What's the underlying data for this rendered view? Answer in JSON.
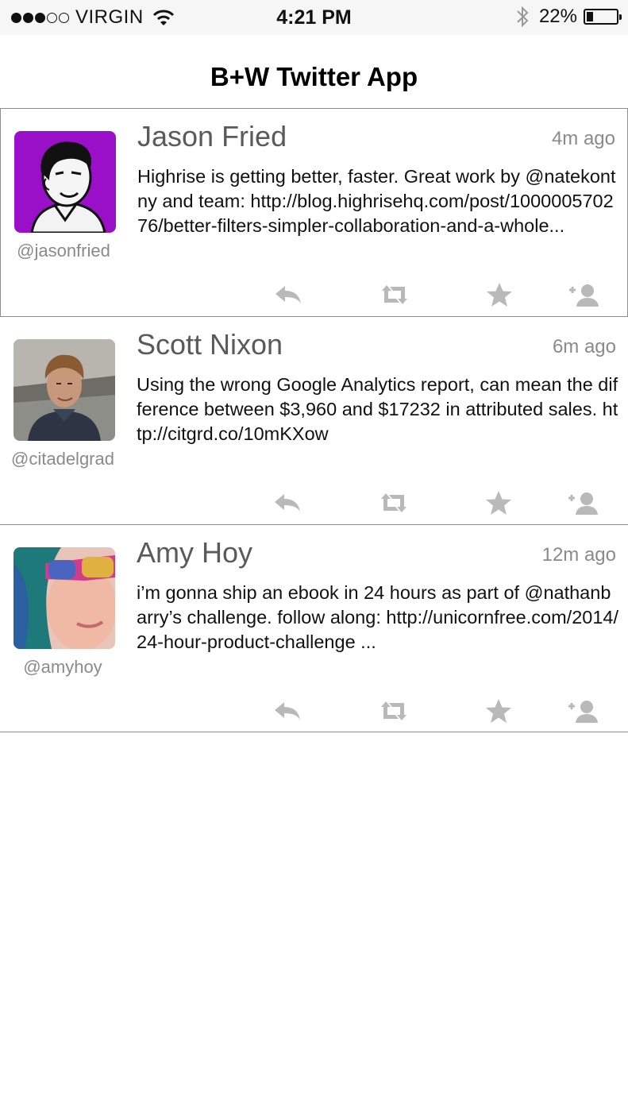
{
  "status_bar": {
    "carrier": "VIRGIN",
    "time": "4:21 PM",
    "battery_percent_text": "22%",
    "battery_level": 0.22
  },
  "header": {
    "title": "B+W Twitter App"
  },
  "tweets": [
    {
      "name": "Jason Fried",
      "handle": "@jasonfried",
      "time_ago": "4m ago",
      "text": "Highrise is getting better, faster. Great work by @natekontny and team: http://blog.highrisehq.com/post/100000570276/better-filters-simpler-collaboration-and-a-whole..."
    },
    {
      "name": "Scott Nixon",
      "handle": "@citadelgrad",
      "time_ago": "6m ago",
      "text": "Using the wrong Google Analytics report, can mean the difference between $3,960 and $17232 in attributed sales. http://citgrd.co/10mKXow"
    },
    {
      "name": "Amy Hoy",
      "handle": "@amyhoy",
      "time_ago": "12m ago",
      "text": "i’m gonna ship an ebook in 24 hours as part of @nathanbarry’s challenge. follow along: http://unicornfree.com/2014/24-hour-product-challenge ..."
    }
  ],
  "icons": {
    "reply": "reply-icon",
    "retweet": "retweet-icon",
    "favorite": "star-icon",
    "follow": "add-user-icon",
    "icon_color": "#b9b9b9"
  }
}
